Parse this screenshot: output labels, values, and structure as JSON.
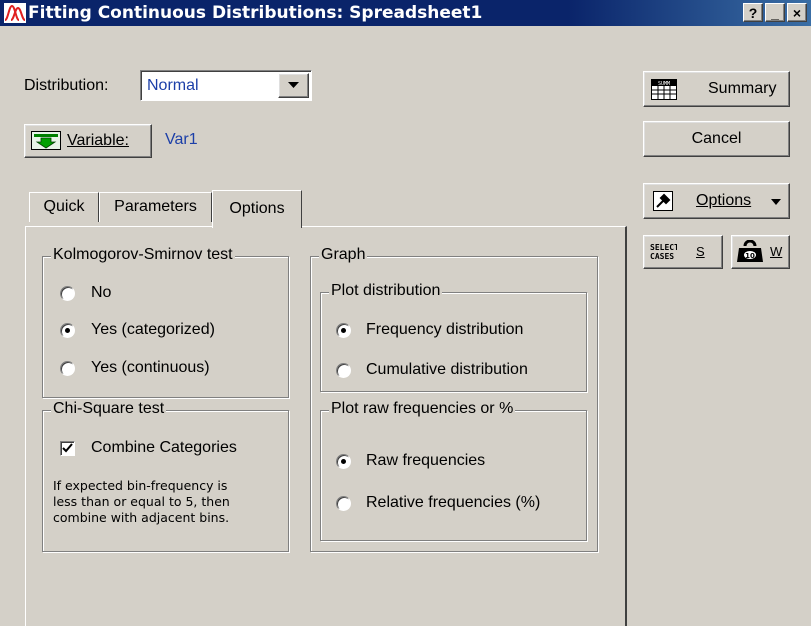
{
  "window": {
    "title": "Fitting Continuous Distributions: Spreadsheet1",
    "controls": {
      "help": "?",
      "minimize": "_",
      "close": "×"
    }
  },
  "distribution": {
    "label": "Distribution:",
    "value": "Normal"
  },
  "variable": {
    "button_label": "Variable:",
    "value": "Var1"
  },
  "tabs": [
    {
      "label": "Quick"
    },
    {
      "label": "Parameters"
    },
    {
      "label": "Options",
      "active": true
    }
  ],
  "ks_test": {
    "title": "Kolmogorov-Smirnov test",
    "options": [
      {
        "label": "No",
        "selected": false
      },
      {
        "label": "Yes (categorized)",
        "selected": true
      },
      {
        "label": "Yes (continuous)",
        "selected": false
      }
    ]
  },
  "chi_square": {
    "title": "Chi-Square test",
    "checkbox_label": "Combine Categories",
    "checked": true,
    "note_lines": [
      "If expected bin-frequency is",
      "less than or equal to 5, then",
      "combine with adjacent bins."
    ]
  },
  "graph": {
    "title": "Graph",
    "plot_distribution": {
      "title": "Plot distribution",
      "options": [
        {
          "label": "Frequency distribution",
          "selected": true
        },
        {
          "label": "Cumulative distribution",
          "selected": false
        }
      ]
    },
    "plot_raw": {
      "title": "Plot raw frequencies or %",
      "options": [
        {
          "label": "Raw frequencies",
          "selected": true
        },
        {
          "label": "Relative frequencies (%)",
          "selected": false
        }
      ]
    }
  },
  "side_buttons": {
    "summary": {
      "label": "Summary",
      "icon_text": "SUMM"
    },
    "cancel": {
      "label": "Cancel"
    },
    "options": {
      "label": "Options"
    },
    "select_cases": {
      "icon_text_line1": "SELECT",
      "icon_text_line2": "CASES",
      "shortcut": "S"
    },
    "weight": {
      "shortcut": "W"
    }
  }
}
